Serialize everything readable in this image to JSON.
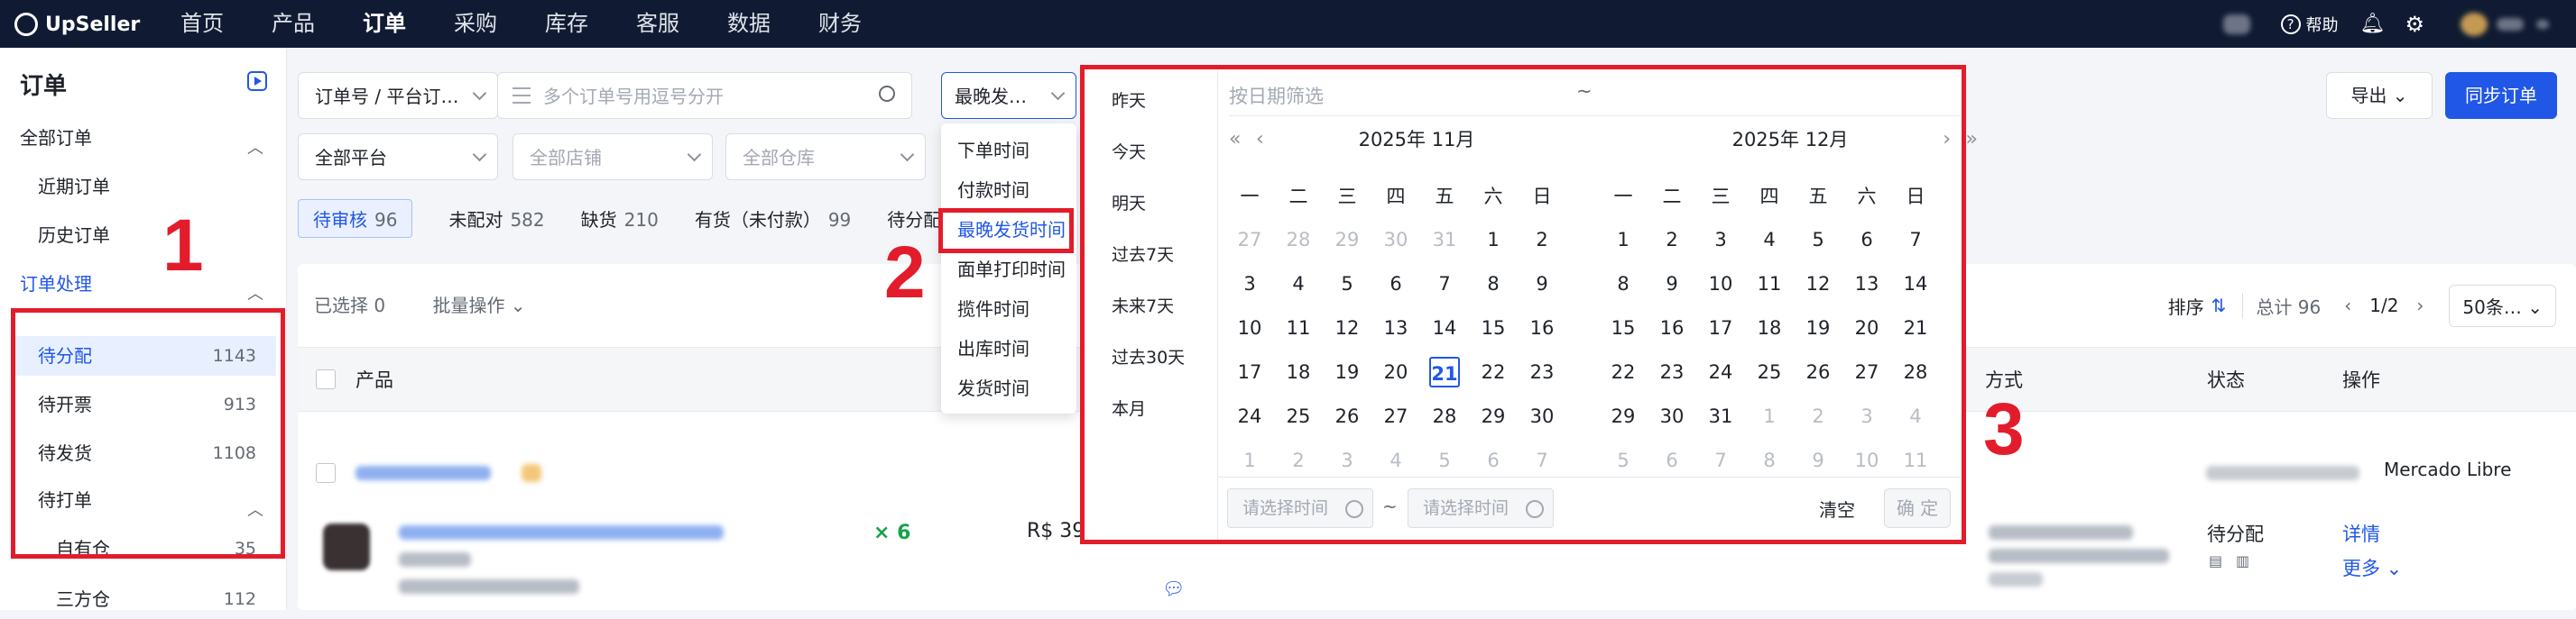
{
  "topbar": {
    "brand": "UpSeller",
    "nav": [
      "首页",
      "产品",
      "订单",
      "采购",
      "库存",
      "客服",
      "数据",
      "财务"
    ],
    "active_nav": "订单",
    "help": "帮助"
  },
  "sidebar": {
    "title": "订单",
    "groups": [
      {
        "label": "全部订单",
        "kind": "group"
      },
      {
        "label": "近期订单",
        "kind": "item"
      },
      {
        "label": "历史订单",
        "kind": "item"
      },
      {
        "label": "订单处理",
        "kind": "group-active"
      },
      {
        "label": "待分配",
        "count": "1143",
        "kind": "item-active"
      },
      {
        "label": "待开票",
        "count": "913",
        "kind": "item"
      },
      {
        "label": "待发货",
        "count": "1108",
        "kind": "item"
      },
      {
        "label": "待打单",
        "kind": "group"
      },
      {
        "label": "自有仓",
        "count": "35",
        "kind": "sub"
      },
      {
        "label": "三方仓",
        "count": "112",
        "kind": "sub"
      }
    ]
  },
  "filters": {
    "order_type": "订单号 / 平台订…",
    "search_placeholder": "多个订单号用逗号分开",
    "time_field": "最晚发…",
    "platform": "全部平台",
    "store_placeholder": "全部店铺",
    "warehouse_placeholder": "全部仓库"
  },
  "header_buttons": {
    "export": "导出",
    "sync": "同步订单"
  },
  "tabs": [
    {
      "label": "待审核",
      "count": "96"
    },
    {
      "label": "未配对",
      "count": "582"
    },
    {
      "label": "缺货",
      "count": "210"
    },
    {
      "label": "有货（未付款）",
      "count": "99"
    },
    {
      "label": "待分配物流",
      "count": ""
    }
  ],
  "toolbar": {
    "selected": "已选择 0",
    "batch": "批量操作",
    "sort": "排序",
    "total": "总计 96",
    "pager": "1/2",
    "per_page": "50条…"
  },
  "table": {
    "columns": [
      "产品",
      "方式",
      "状态",
      "操作"
    ],
    "row": {
      "qty": "× 6",
      "price": "R$ 39",
      "status": "待分配",
      "detail": "详情",
      "more": "更多",
      "platform": "Mercado Libre"
    }
  },
  "dropdown": {
    "items": [
      "下单时间",
      "付款时间",
      "最晚发货时间",
      "面单打印时间",
      "揽件时间",
      "出库时间",
      "发货时间"
    ],
    "active": "最晚发货时间"
  },
  "datepicker": {
    "placeholder": "按日期筛选",
    "separator": "~",
    "shortcuts": [
      "昨天",
      "今天",
      "明天",
      "过去7天",
      "未来7天",
      "过去30天",
      "本月"
    ],
    "weekdays": [
      "一",
      "二",
      "三",
      "四",
      "五",
      "六",
      "日"
    ],
    "months": [
      {
        "title": "2025年 11月",
        "days": [
          [
            "27",
            "28",
            "29",
            "30",
            "31",
            "1",
            "2"
          ],
          [
            "3",
            "4",
            "5",
            "6",
            "7",
            "8",
            "9"
          ],
          [
            "10",
            "11",
            "12",
            "13",
            "14",
            "15",
            "16"
          ],
          [
            "17",
            "18",
            "19",
            "20",
            "21",
            "22",
            "23"
          ],
          [
            "24",
            "25",
            "26",
            "27",
            "28",
            "29",
            "30"
          ],
          [
            "1",
            "2",
            "3",
            "4",
            "5",
            "6",
            "7"
          ]
        ],
        "dim_first_row_count": 5,
        "dim_last_row": true,
        "today": "21"
      },
      {
        "title": "2025年 12月",
        "days": [
          [
            "1",
            "2",
            "3",
            "4",
            "5",
            "6",
            "7"
          ],
          [
            "8",
            "9",
            "10",
            "11",
            "12",
            "13",
            "14"
          ],
          [
            "15",
            "16",
            "17",
            "18",
            "19",
            "20",
            "21"
          ],
          [
            "22",
            "23",
            "24",
            "25",
            "26",
            "27",
            "28"
          ],
          [
            "29",
            "30",
            "31",
            "1",
            "2",
            "3",
            "4"
          ],
          [
            "5",
            "6",
            "7",
            "8",
            "9",
            "10",
            "11"
          ]
        ],
        "dim_first_row_count": 0,
        "dim_tail_start": 31
      }
    ],
    "time_placeholder": "请选择时间",
    "clear": "清空",
    "confirm": "确 定"
  },
  "annotations": [
    "1",
    "2",
    "3"
  ],
  "colors": {
    "accent": "#2157e6",
    "highlight": "#e31c2b",
    "topbar": "#101b33"
  }
}
